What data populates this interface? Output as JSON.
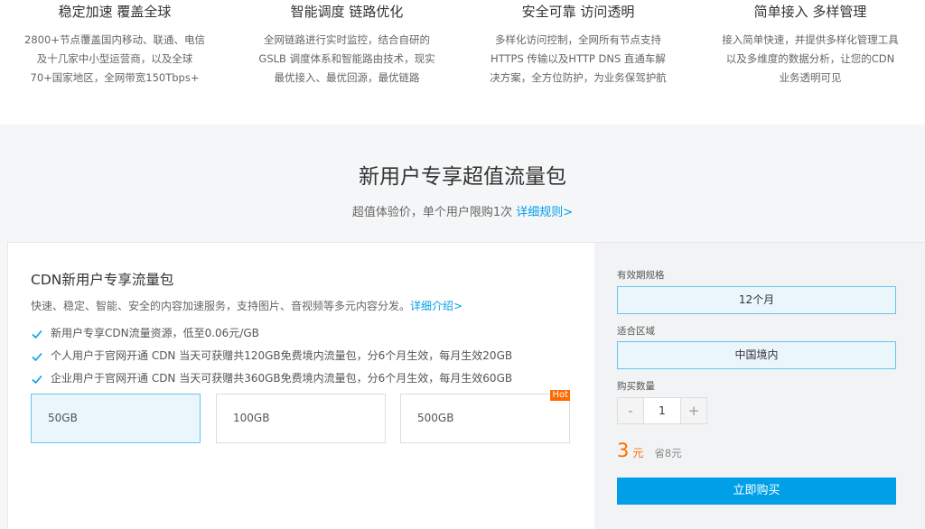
{
  "features": [
    {
      "title": "稳定加速 覆盖全球",
      "lines": [
        "2800+节点覆盖国内移动、联通、电信",
        "及十几家中小型运营商，以及全球",
        "70+国家地区，全网带宽150Tbps+"
      ]
    },
    {
      "title": "智能调度 链路优化",
      "lines": [
        "全网链路进行实时监控，结合自研的",
        "GSLB 调度体系和智能路由技术，现实",
        "最优接入、最优回源，最优链路"
      ]
    },
    {
      "title": "安全可靠 访问透明",
      "lines": [
        "多样化访问控制，全网所有节点支持",
        "HTTPS 传输以及HTTP DNS 直通车解",
        "决方案，全方位防护，为业务保驾护航"
      ]
    },
    {
      "title": "简单接入 多样管理",
      "lines": [
        "接入简单快速，并提供多样化管理工具",
        "以及多维度的数据分析，让您的CDN",
        "业务透明可见"
      ]
    }
  ],
  "promo": {
    "title": "新用户专享超值流量包",
    "subtitle": "超值体验价，单个用户限购1次",
    "rules_link": "详细规则>"
  },
  "package": {
    "title": "CDN新用户专享流量包",
    "desc": "快速、稳定、智能、安全的内容加速服务，支持图片、音视频等多元内容分发。",
    "desc_link": "详细介绍>",
    "features": [
      "新用户专享CDN流量资源，低至0.06元/GB",
      "个人用户于官网开通 CDN 当天可获赠共120GB免费境内流量包，分6个月生效，每月生效20GB",
      "企业用户于官网开通 CDN 当天可获赠共360GB免费境内流量包，分6个月生效，每月生效60GB"
    ],
    "options": [
      "50GB",
      "100GB",
      "500GB"
    ],
    "hot_badge": "Hot"
  },
  "order": {
    "validity_label": "有效期规格",
    "validity_value": "12个月",
    "region_label": "适合区域",
    "region_value": "中国境内",
    "qty_label": "购买数量",
    "qty_minus": "-",
    "qty_value": "1",
    "qty_plus": "+",
    "price": "3",
    "price_unit": "元",
    "save": "省8元",
    "buy": "立即购买"
  },
  "colors": {
    "accent": "#00a0e9",
    "price": "#ff6a00"
  }
}
